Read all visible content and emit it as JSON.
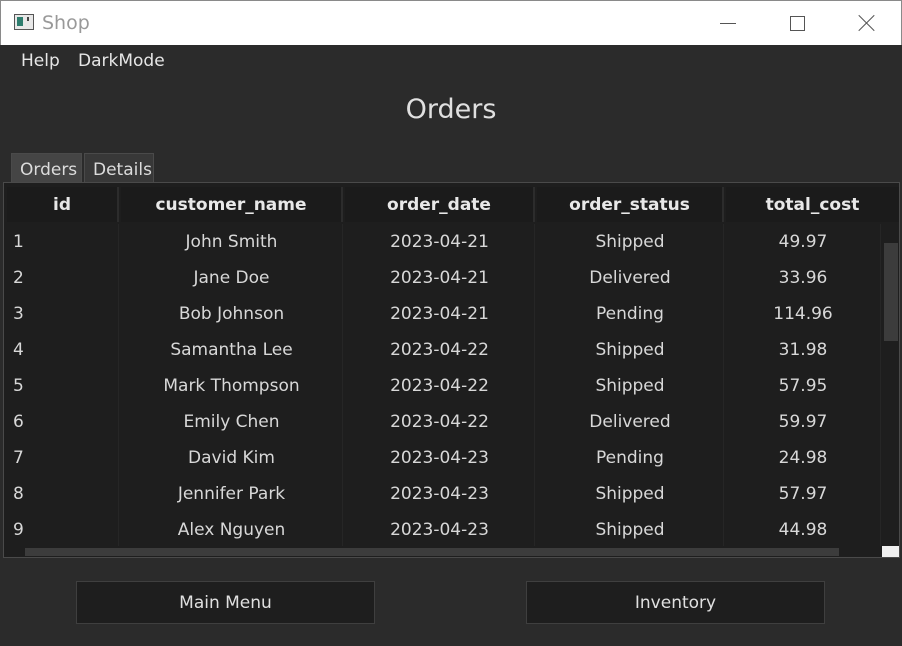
{
  "window": {
    "title": "Shop"
  },
  "menu": {
    "items": [
      "Help",
      "DarkMode"
    ]
  },
  "page_title": "Orders",
  "tabs": [
    "Orders",
    "Details"
  ],
  "table": {
    "columns": [
      "id",
      "customer_name",
      "order_date",
      "order_status",
      "total_cost"
    ],
    "rows": [
      [
        "1",
        "John Smith",
        "2023-04-21",
        "Shipped",
        "49.97"
      ],
      [
        "2",
        "Jane Doe",
        "2023-04-21",
        "Delivered",
        "33.96"
      ],
      [
        "3",
        "Bob Johnson",
        "2023-04-21",
        "Pending",
        "114.96"
      ],
      [
        "4",
        "Samantha Lee",
        "2023-04-22",
        "Shipped",
        "31.98"
      ],
      [
        "5",
        "Mark Thompson",
        "2023-04-22",
        "Shipped",
        "57.95"
      ],
      [
        "6",
        "Emily Chen",
        "2023-04-22",
        "Delivered",
        "59.97"
      ],
      [
        "7",
        "David Kim",
        "2023-04-23",
        "Pending",
        "24.98"
      ],
      [
        "8",
        "Jennifer Park",
        "2023-04-23",
        "Shipped",
        "57.97"
      ],
      [
        "9",
        "Alex Nguyen",
        "2023-04-23",
        "Shipped",
        "44.98"
      ]
    ]
  },
  "buttons": {
    "main_menu": "Main Menu",
    "inventory": "Inventory"
  },
  "colors": {
    "background": "#2b2b2b",
    "table_bg": "#1e1e1e",
    "text": "#e6e6e6"
  }
}
